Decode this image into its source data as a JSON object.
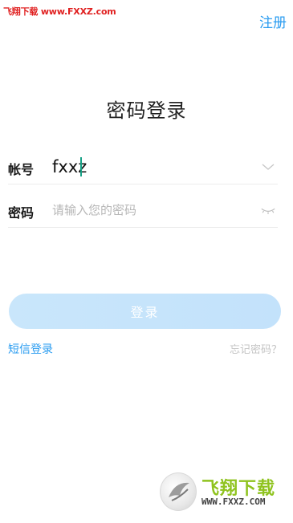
{
  "watermark": {
    "top_text": "飞翔下载 www.FXXZ.com",
    "brand": "飞翔下载",
    "url": "WWW.FXXZ.COM"
  },
  "header": {
    "register_label": "注册"
  },
  "title": "密码登录",
  "form": {
    "account": {
      "label": "帐号",
      "value": "fxxz",
      "icon": "chevron-down-icon"
    },
    "password": {
      "label": "密码",
      "placeholder": "请输入您的密码",
      "icon": "eye-closed-icon"
    }
  },
  "actions": {
    "login_label": "登录",
    "sms_login_label": "短信登录",
    "forgot_password_label": "忘记密码？"
  },
  "colors": {
    "accent": "#2a9cf0",
    "button_disabled": "#c9e6fb",
    "placeholder": "#b6b6b6"
  }
}
